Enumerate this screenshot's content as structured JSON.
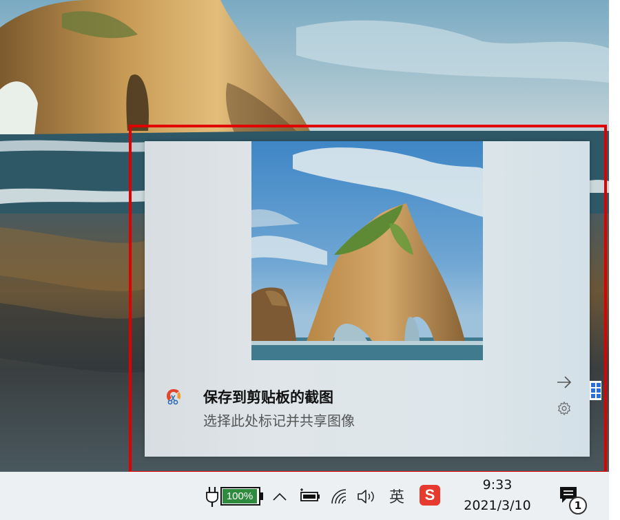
{
  "toast": {
    "title": "保存到剪贴板的截图",
    "body": "选择此处标记并共享图像",
    "highlight_color": "#e00000"
  },
  "icons": {
    "app": "snip-sketch-icon",
    "expand": "arrow-right-icon",
    "settings": "gear-icon"
  },
  "taskbar": {
    "battery_percent": "100%",
    "ime": "英",
    "sogou": "S",
    "time": "9:33",
    "date": "2021/3/10",
    "notification_count": "1"
  },
  "colors": {
    "battery_fill": "#2e8b3e",
    "sogou_red": "#e63a2e",
    "taskbar_bg": "#ecf0f3"
  }
}
